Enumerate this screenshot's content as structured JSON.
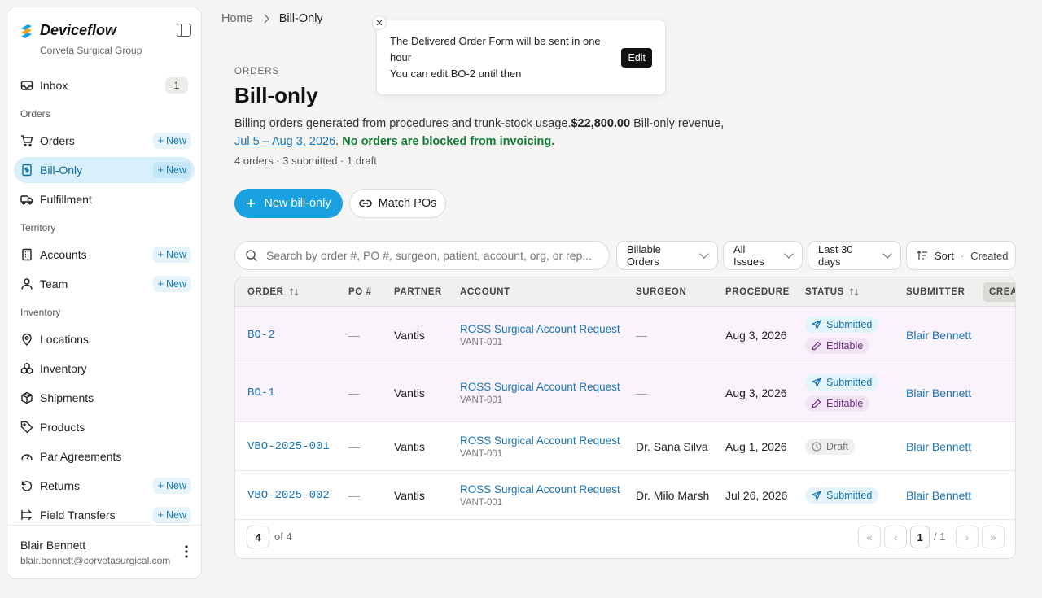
{
  "app": {
    "name": "Deviceflow",
    "org": "Corveta Surgical Group"
  },
  "sidebar": {
    "inbox": {
      "label": "Inbox",
      "count": "1"
    },
    "sections": {
      "orders": "Orders",
      "territory": "Territory",
      "inventory": "Inventory"
    },
    "items": {
      "orders": {
        "label": "Orders",
        "new": "New"
      },
      "billonly": {
        "label": "Bill-Only",
        "new": "New"
      },
      "fulfillment": {
        "label": "Fulfillment"
      },
      "accounts": {
        "label": "Accounts",
        "new": "New"
      },
      "team": {
        "label": "Team",
        "new": "New"
      },
      "locations": {
        "label": "Locations"
      },
      "inventory": {
        "label": "Inventory"
      },
      "shipments": {
        "label": "Shipments"
      },
      "products": {
        "label": "Products"
      },
      "par": {
        "label": "Par Agreements"
      },
      "returns": {
        "label": "Returns",
        "new": "New"
      },
      "transfers": {
        "label": "Field Transfers",
        "new": "New"
      }
    },
    "user": {
      "name": "Blair Bennett",
      "email": "blair.bennett@corvetasurgical.com"
    }
  },
  "breadcrumb": {
    "home": "Home",
    "current": "Bill-Only"
  },
  "toast": {
    "line1": "The Delivered Order Form will be sent in one hour",
    "line2": "You can edit BO-2 until then",
    "action": "Edit"
  },
  "header": {
    "eyebrow": "ORDERS",
    "title": "Bill-only",
    "desc_lead": "Billing orders generated from procedures and trunk-stock usage.",
    "revenue": "$22,800.00",
    "revenue_suffix": " Bill-only revenue,",
    "range": "Jul 5 – Aug 3, 2026",
    "dot": ".",
    "status_ok": "No orders are blocked from invoicing.",
    "counts": "4 orders · 3 submitted · 1 draft"
  },
  "actions": {
    "new_bill_only": "New bill-only",
    "match_pos": "Match POs"
  },
  "filters": {
    "search_placeholder": "Search by order #, PO #, surgeon, patient, account, org, or rep...",
    "billable": "Billable Orders",
    "issues": "All Issues",
    "period": "Last 30 days",
    "sort_label": "Sort",
    "sort_sep": "·",
    "sort_value": "Created"
  },
  "table": {
    "columns": {
      "order": "ORDER",
      "po": "PO #",
      "partner": "PARTNER",
      "account": "ACCOUNT",
      "surgeon": "SURGEON",
      "procedure": "PROCEDURE",
      "status": "STATUS",
      "submitter": "SUBMITTER",
      "created": "CREATED"
    },
    "rows": [
      {
        "order": "BO-2",
        "po": "—",
        "partner": "Vantis",
        "account": "ROSS Surgical Account Request",
        "account_code": "VANT-001",
        "surgeon": "—",
        "procedure": "Aug 3, 2026",
        "status1": "Submitted",
        "status2": "Editable",
        "submitter": "Blair Bennett"
      },
      {
        "order": "BO-1",
        "po": "—",
        "partner": "Vantis",
        "account": "ROSS Surgical Account Request",
        "account_code": "VANT-001",
        "surgeon": "—",
        "procedure": "Aug 3, 2026",
        "status1": "Submitted",
        "status2": "Editable",
        "submitter": "Blair Bennett"
      },
      {
        "order": "VBO-2025-001",
        "po": "—",
        "partner": "Vantis",
        "account": "ROSS Surgical Account Request",
        "account_code": "VANT-001",
        "surgeon": "Dr. Sana Silva",
        "procedure": "Aug 1, 2026",
        "status1": "Draft",
        "submitter": "Blair Bennett"
      },
      {
        "order": "VBO-2025-002",
        "po": "—",
        "partner": "Vantis",
        "account": "ROSS Surgical Account Request",
        "account_code": "VANT-001",
        "surgeon": "Dr. Milo Marsh",
        "procedure": "Jul 26, 2026",
        "status1": "Submitted",
        "submitter": "Blair Bennett"
      }
    ]
  },
  "pagination": {
    "page_size": "4",
    "of_total": "of 4",
    "current": "1",
    "sep": "/",
    "pages": "1"
  },
  "colors": {
    "accent": "#18a0e0",
    "link": "#1a73b5",
    "success": "#0f7a34",
    "editable": "#6d2d80"
  }
}
